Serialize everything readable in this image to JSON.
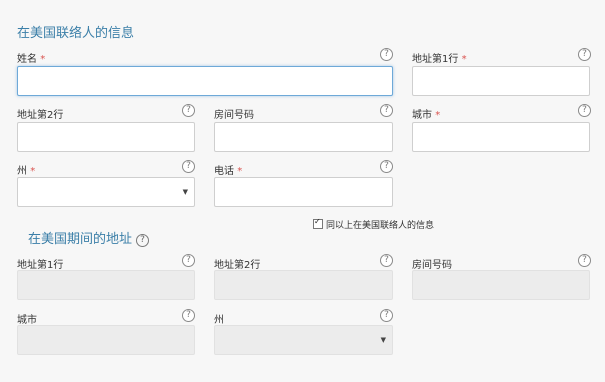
{
  "section1": {
    "title": "在美国联络人的信息",
    "fields": {
      "name_label": "姓名",
      "addr1_label": "地址第1行",
      "addr2_label": "地址第2行",
      "room_label": "房间号码",
      "city_label": "城市",
      "state_label": "州",
      "phone_label": "电话"
    },
    "required_mark": "*"
  },
  "checkbox": {
    "label": "同以上在美国联络人的信息",
    "checked": true
  },
  "section2": {
    "title": "在美国期间的地址",
    "fields": {
      "addr1_label": "地址第1行",
      "addr2_label": "地址第2行",
      "room_label": "房间号码",
      "city_label": "城市",
      "state_label": "州"
    }
  },
  "help_glyph": "?",
  "select_arrow": "▼",
  "colors": {
    "accent": "#3b7fa8",
    "required": "#d9534f",
    "focus_border": "#6ea9d8"
  },
  "icons": {
    "help": "question-circle-icon",
    "select": "caret-down-icon",
    "checkbox": "checkmark-icon"
  }
}
